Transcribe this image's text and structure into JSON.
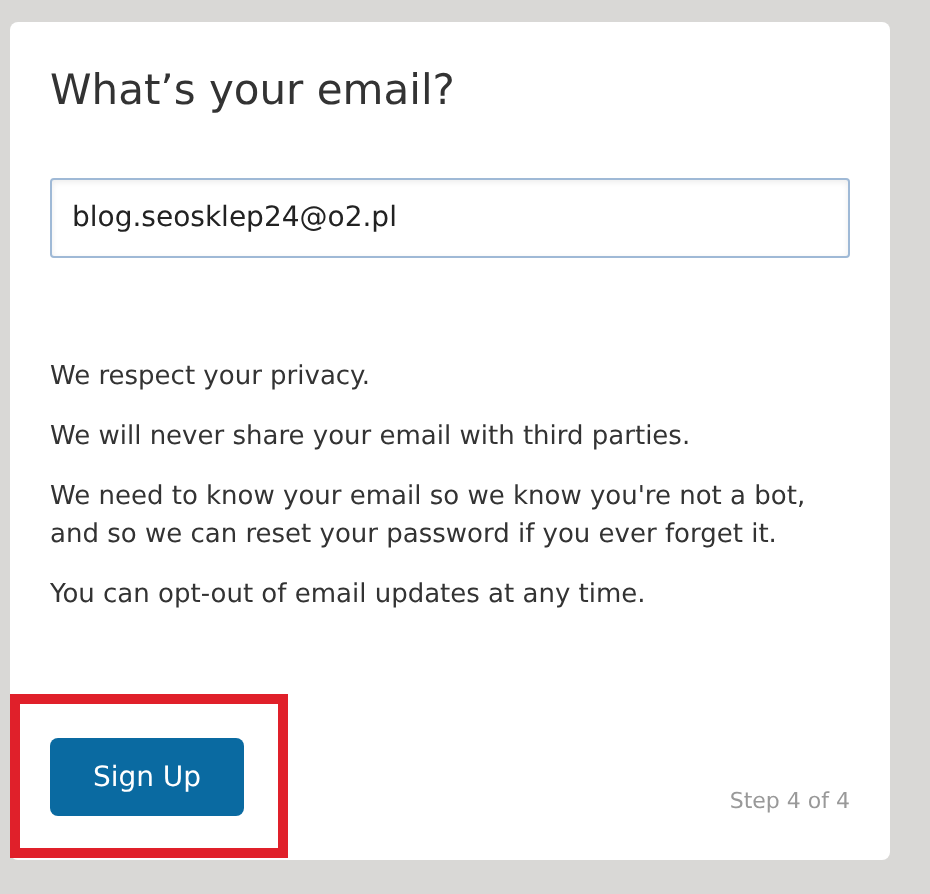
{
  "dialog": {
    "title": "What’s your email?",
    "email_field": {
      "value": "blog.seosklep24@o2.pl"
    },
    "paragraphs": [
      "We respect your privacy.",
      "We will never share your email with third parties.",
      "We need to know your email so we know you're not a bot, and so we can reset your password if you ever forget it.",
      "You can opt-out of email updates at any time."
    ],
    "button": {
      "label": "Sign Up",
      "highlighted": true
    },
    "step": "Step 4 of 4"
  }
}
